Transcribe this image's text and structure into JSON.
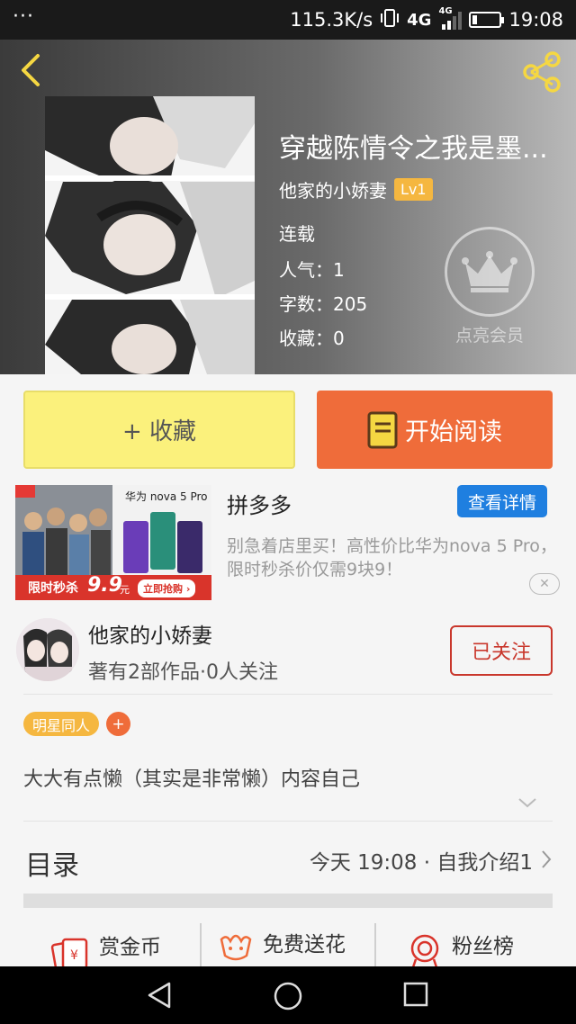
{
  "status_bar": {
    "menu_dots": "···",
    "net_speed": "115.3K/s",
    "network": "4G",
    "network_small": "4G",
    "time": "19:08"
  },
  "book": {
    "title": "穿越陈情令之我是墨...",
    "author": "他家的小娇妻",
    "level": "Lv1",
    "status": "连载",
    "popularity_label": "人气：",
    "popularity": "1",
    "words_label": "字数：",
    "words": "205",
    "favorites_label": "收藏：",
    "favorites": "0",
    "vip_label": "点亮会员"
  },
  "actions": {
    "collect": "+ 收藏",
    "read": "开始阅读"
  },
  "ad": {
    "title": "拼多多",
    "detail_button": "查看详情",
    "desc": "别急着店里买！高性价比华为nova 5 Pro，限时秒杀价仅需9块9！",
    "close": "✕",
    "img_brand": "华为 nova 5 Pro",
    "img_promo": "限时秒杀",
    "img_price": "9.9",
    "img_price_unit": "元",
    "img_cta": "立即抢购 ›"
  },
  "author_block": {
    "name": "他家的小娇妻",
    "stats": "著有2部作品·0人关注",
    "follow": "已关注"
  },
  "tags": {
    "items": [
      "明星同人"
    ],
    "add": "+"
  },
  "intro": "大大有点懒（其实是非常懒）内容自己",
  "catalog": {
    "title": "目录",
    "latest": "今天 19:08 · 自我介绍1"
  },
  "bottom_actions": {
    "coins": "赏金币",
    "flowers": "免费送花",
    "fans": "粉丝榜"
  },
  "colors": {
    "accent_orange": "#ef6c3a",
    "collect_yellow": "#fbf17c",
    "level_gold": "#f5b740",
    "follow_red": "#c9372c",
    "ad_blue": "#1f7fe0"
  }
}
